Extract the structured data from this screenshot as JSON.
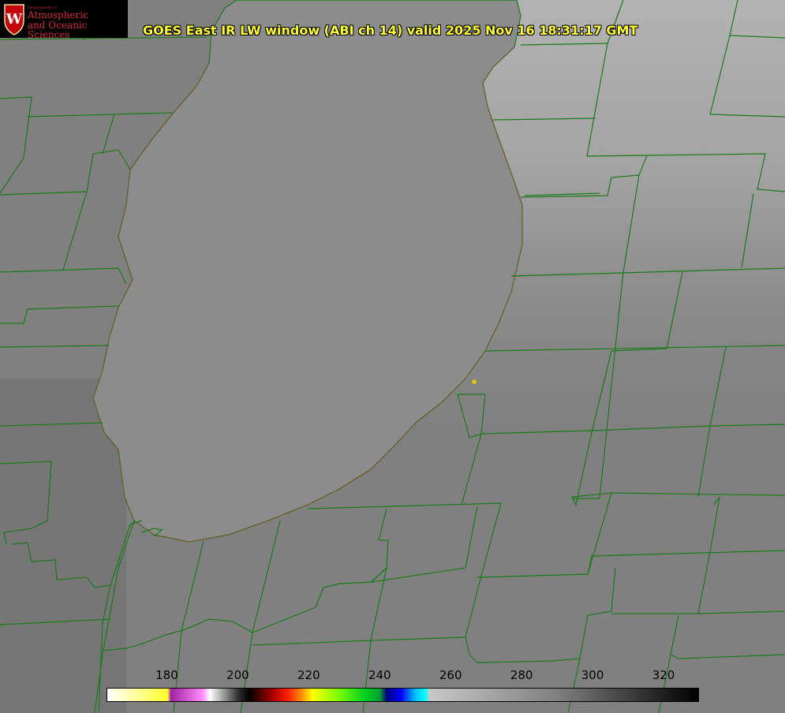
{
  "title": "GOES East IR LW window (ABI ch 14) valid 2025 Nov 16 18:31:17 GMT",
  "logo": {
    "small_text": "Department of",
    "line1": "Atmospheric",
    "line2": "and Oceanic Sciences",
    "emblem": "W"
  },
  "colorbar": {
    "ticks": [
      "180",
      "200",
      "220",
      "240",
      "260",
      "280",
      "300",
      "320"
    ],
    "tick_values": [
      180,
      200,
      220,
      240,
      260,
      280,
      300,
      320
    ],
    "range": [
      163,
      330
    ],
    "stops": [
      {
        "v": 163,
        "c": "#ffffff"
      },
      {
        "v": 180,
        "c": "#ffff30"
      },
      {
        "v": 181,
        "c": "#a020a0"
      },
      {
        "v": 190,
        "c": "#ff90ff"
      },
      {
        "v": 192,
        "c": "#ffffff"
      },
      {
        "v": 200,
        "c": "#303030"
      },
      {
        "v": 203,
        "c": "#000000"
      },
      {
        "v": 210,
        "c": "#b00000"
      },
      {
        "v": 214,
        "c": "#ff2000"
      },
      {
        "v": 218,
        "c": "#ff9000"
      },
      {
        "v": 221,
        "c": "#ffff00"
      },
      {
        "v": 228,
        "c": "#80ff00"
      },
      {
        "v": 236,
        "c": "#00d020"
      },
      {
        "v": 240,
        "c": "#00a030"
      },
      {
        "v": 242,
        "c": "#000080"
      },
      {
        "v": 246,
        "c": "#0000ff"
      },
      {
        "v": 250,
        "c": "#00c0ff"
      },
      {
        "v": 253,
        "c": "#00ffff"
      },
      {
        "v": 254,
        "c": "#c8c8c8"
      },
      {
        "v": 290,
        "c": "#808080"
      },
      {
        "v": 330,
        "c": "#000000"
      }
    ]
  },
  "colors": {
    "boundary": "#1a7a1a",
    "lake": "#8c8c8c",
    "shoreline": "#e03030",
    "marker": "#d8c800"
  }
}
